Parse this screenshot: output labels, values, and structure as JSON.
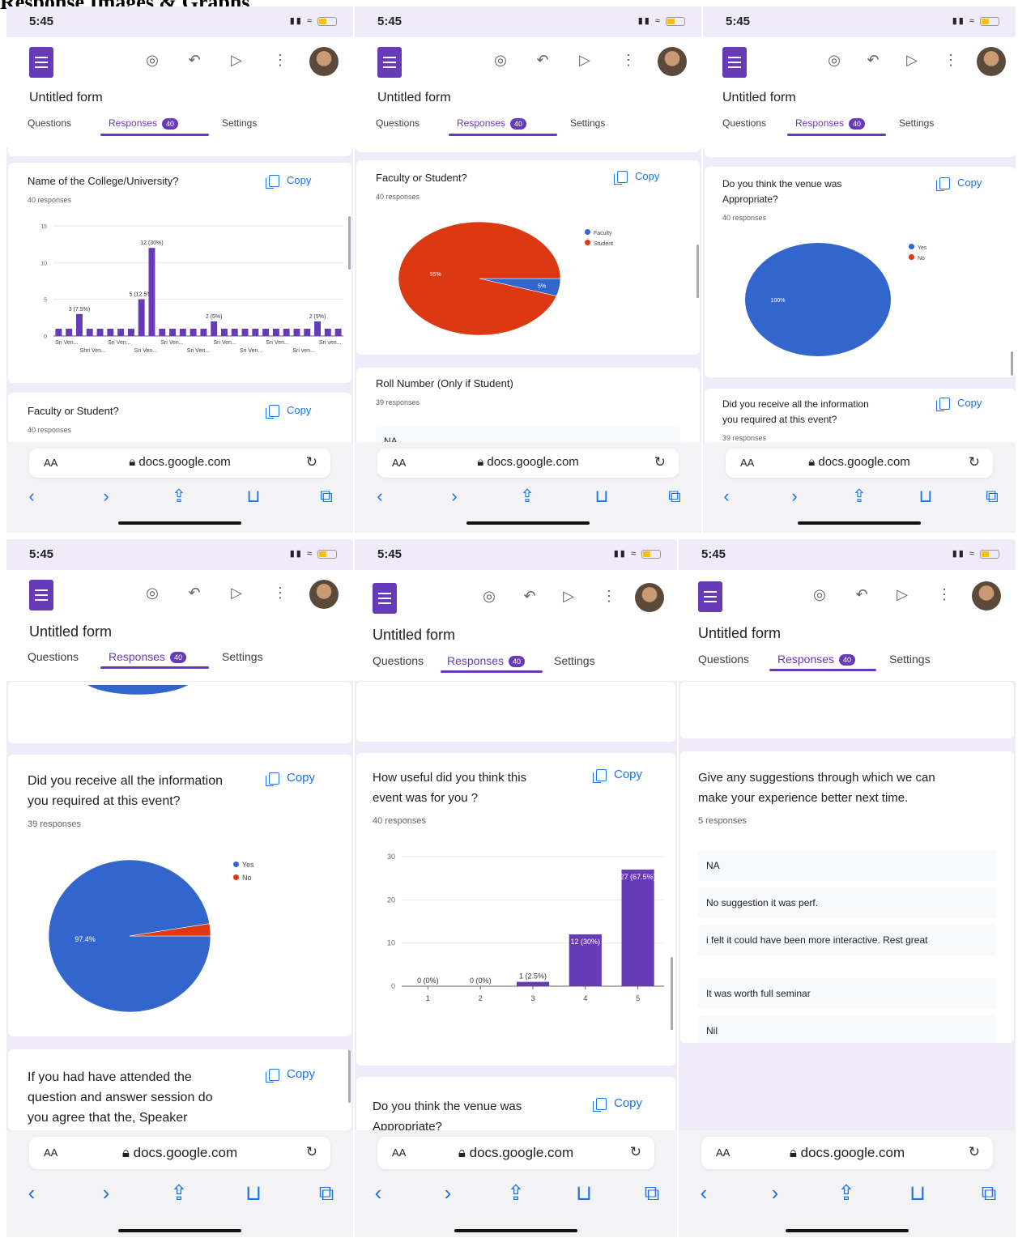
{
  "caption": "Response Images & Graphs",
  "time": "5:45",
  "form_title": "Untitled form",
  "tabs": {
    "questions": "Questions",
    "responses": "Responses",
    "responses_count": "40",
    "settings": "Settings"
  },
  "copy_label": "Copy",
  "browser": {
    "aa": "AA",
    "url": "docs.google.com"
  },
  "icons": [
    "forms-logo-icon",
    "palette-icon",
    "undo-icon",
    "send-icon",
    "more-vert-icon",
    "avatar",
    "lock-icon",
    "reload-icon",
    "back-icon",
    "forward-icon",
    "share-icon",
    "bookmarks-icon",
    "tabs-icon"
  ],
  "colors": {
    "accent": "#673ab7",
    "blue": "#3366cc",
    "red": "#dc3912",
    "link": "#1a73e8",
    "bg": "#f0ebf8"
  },
  "cards": {
    "college": {
      "question": "Name of the College/University?",
      "responses": "40 responses"
    },
    "faculty": {
      "question": "Faculty or Student?",
      "responses": "40 responses"
    },
    "roll": {
      "question": "Roll Number (Only if Student)",
      "responses": "39 responses",
      "first_answer": "NA"
    },
    "venue": {
      "question_l1": "Do you think the venue was",
      "question_l2": "Appropriate?",
      "responses": "40 responses"
    },
    "info": {
      "question_l1": "Did you receive all the information",
      "question_l2": "you required at this event?",
      "responses": "39 responses"
    },
    "speaker": {
      "question_l1": "If you had have attended the",
      "question_l2": "question and answer session do",
      "question_l3": "you agree that the, Speaker"
    },
    "useful": {
      "question_l1": "How useful did you think this",
      "question_l2": "event was for you ?",
      "responses": "40 responses"
    },
    "suggest": {
      "question_l1": "Give any suggestions through which we can",
      "question_l2": "make your experience better next time.",
      "responses": "5 responses",
      "answers": [
        "NA",
        "No suggestion it was perf.",
        "i felt it could have been more interactive. Rest great",
        "It was worth full seminar",
        "Nil"
      ]
    }
  },
  "chart_data": [
    {
      "type": "bar",
      "title": "Name of the College/University?",
      "categories": [
        "Sri Ven...",
        "Shri Ven...",
        "Sri Ven...",
        "Sri Ven...",
        "Sri Ven...",
        "Sri Ven...",
        "Sri Ven...",
        "Sri Ven...",
        "Sri Ven...",
        "Sri ven...",
        "Sri ven..."
      ],
      "values": [
        1,
        1,
        3,
        1,
        1,
        1,
        1,
        1,
        5,
        12,
        1,
        1,
        1,
        1,
        1,
        2,
        1,
        1,
        1,
        1,
        1,
        1,
        1,
        1,
        1,
        2,
        1,
        1
      ],
      "value_labels": {
        "2": "3 (7.5%)",
        "8": "5 (12.5%)",
        "9": "12 (30%)",
        "15": "2 (5%)",
        "25": "2 (5%)"
      },
      "ylim": [
        0,
        15
      ],
      "yticks": [
        0,
        5,
        10,
        15
      ],
      "color": "#673ab7"
    },
    {
      "type": "pie",
      "title": "Faculty or Student?",
      "labels": [
        "Faculty",
        "Student"
      ],
      "values": [
        5,
        95
      ],
      "slice_labels": [
        "5%",
        "95%"
      ],
      "colors": [
        "#3366cc",
        "#dc3912"
      ]
    },
    {
      "type": "pie",
      "title": "Do you think the venue was Appropriate?",
      "labels": [
        "Yes",
        "No"
      ],
      "values": [
        100,
        0
      ],
      "slice_labels": [
        "100%"
      ],
      "colors": [
        "#3366cc",
        "#dc3912"
      ]
    },
    {
      "type": "pie",
      "title": "Did you receive all the information you required at this event?",
      "labels": [
        "Yes",
        "No"
      ],
      "values": [
        97.4,
        2.6
      ],
      "slice_labels": [
        "97.4%"
      ],
      "colors": [
        "#3366cc",
        "#dc3912"
      ]
    },
    {
      "type": "bar",
      "title": "How useful did you think this event was for you ?",
      "categories": [
        "1",
        "2",
        "3",
        "4",
        "5"
      ],
      "values": [
        0,
        0,
        1,
        12,
        27
      ],
      "value_labels": [
        "0 (0%)",
        "0 (0%)",
        "1 (2.5%)",
        "12 (30%)",
        "27 (67.5%)"
      ],
      "ylim": [
        0,
        30
      ],
      "yticks": [
        0,
        10,
        20,
        30
      ],
      "color": "#673ab7"
    }
  ]
}
